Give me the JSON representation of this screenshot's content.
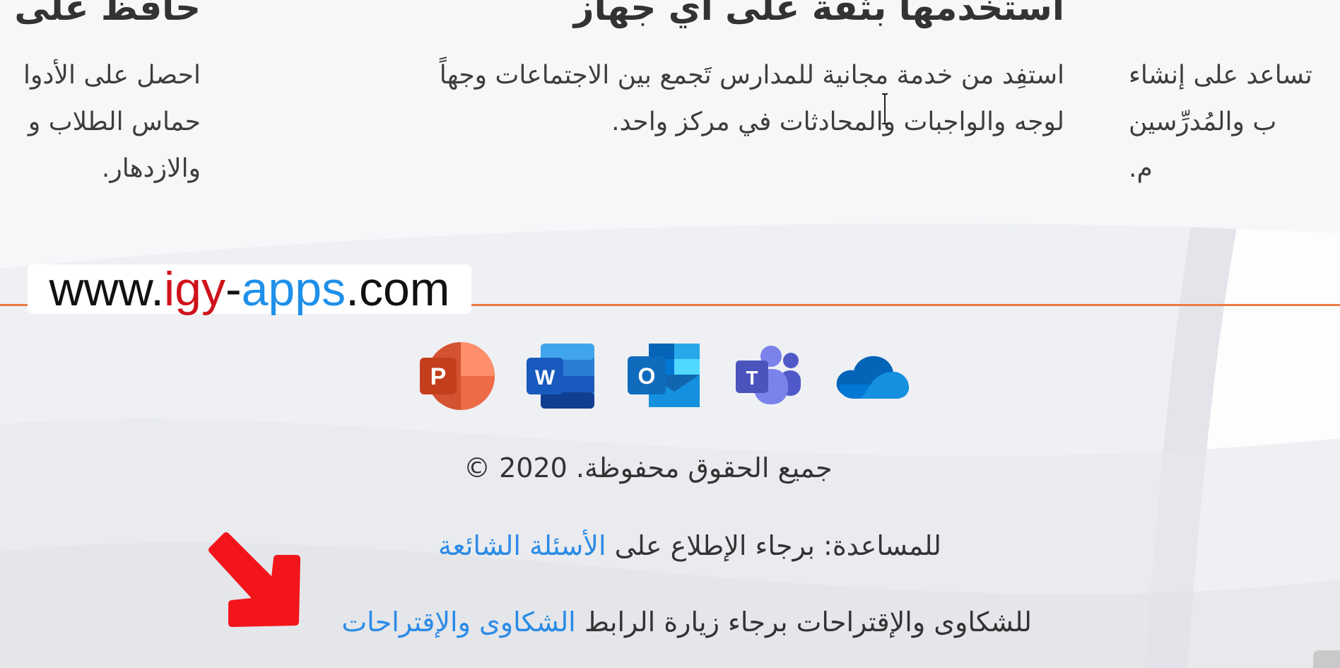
{
  "sections": {
    "left": {
      "heading": "حافظ على",
      "lines": [
        "احصل على الأدوا",
        "حماس الطلاب و",
        "والازدهار."
      ]
    },
    "center": {
      "heading": "استخدمها بثقة على أي جهاز",
      "lines": [
        "استفِد من خدمة مجانية للمدارس تَجمع بين الاجتماعات وجهاً",
        "لوجه والواجبات والمحادثات في مركز واحد."
      ]
    },
    "right": {
      "lines": [
        "تساعد على إنشاء",
        "ب والمُدرِّسين",
        "م."
      ]
    }
  },
  "watermark": {
    "prefix": "www.",
    "part1": "igy",
    "dash": "-",
    "part2": "apps",
    "suffix": ".com"
  },
  "apps": [
    {
      "name": "powerpoint",
      "letter": "P"
    },
    {
      "name": "word",
      "letter": "W"
    },
    {
      "name": "outlook",
      "letter": "O"
    },
    {
      "name": "teams",
      "letter": "T"
    },
    {
      "name": "onedrive",
      "letter": ""
    }
  ],
  "footer": {
    "copyright": "جميع الحقوق محفوظة. 2020 ©",
    "help_text": "للمساعدة: برجاء الإطلاع على ",
    "help_link": "الأسئلة الشائعة",
    "complaints_text": "للشكاوى والإقتراحات برجاء زيارة الرابط ",
    "complaints_link": "الشكاوى والإقتراحات"
  },
  "colors": {
    "divider": "#ec7a43",
    "link": "#2b8be6",
    "arrow": "#f2161b"
  }
}
